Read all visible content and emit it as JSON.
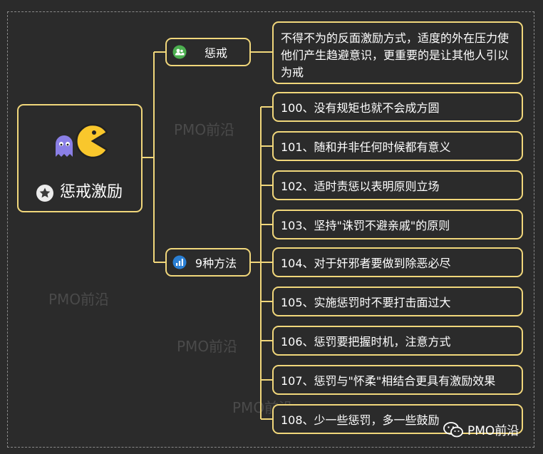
{
  "root": {
    "title": "惩戒激励",
    "mascot_icon": "pacman-ghost-icon",
    "badge_icon": "star-icon"
  },
  "branches": [
    {
      "label": "惩戒",
      "icon": "people-icon",
      "icon_color": "#4caf50",
      "description": "不得不为的反面激励方式，适度的外在压力使他们产生趋避意识，更重要的是让其他人引以为戒"
    },
    {
      "label": "9种方法",
      "icon": "bar-chart-icon",
      "icon_color": "#2a7fd4",
      "items": [
        "100、没有规矩也就不会成方圆",
        "101、随和并非任何时候都有意义",
        "102、适时责惩以表明原则立场",
        "103、坚持\"诛罚不避亲戚\"的原则",
        "104、对于奸邪者要做到除恶必尽",
        "105、实施惩罚时不要打击面过大",
        "106、惩罚要把握时机，注意方式",
        "107、惩罚与\"怀柔\"相结合更具有激励效果",
        "108、少一些惩罚，多一些鼓励"
      ]
    }
  ],
  "watermark": "PMO前沿",
  "footer": {
    "brand": "PMO前沿",
    "icon": "wechat-icon"
  },
  "colors": {
    "border": "#f1d77b",
    "background": "#2b2b2b",
    "text": "#ffffff"
  }
}
